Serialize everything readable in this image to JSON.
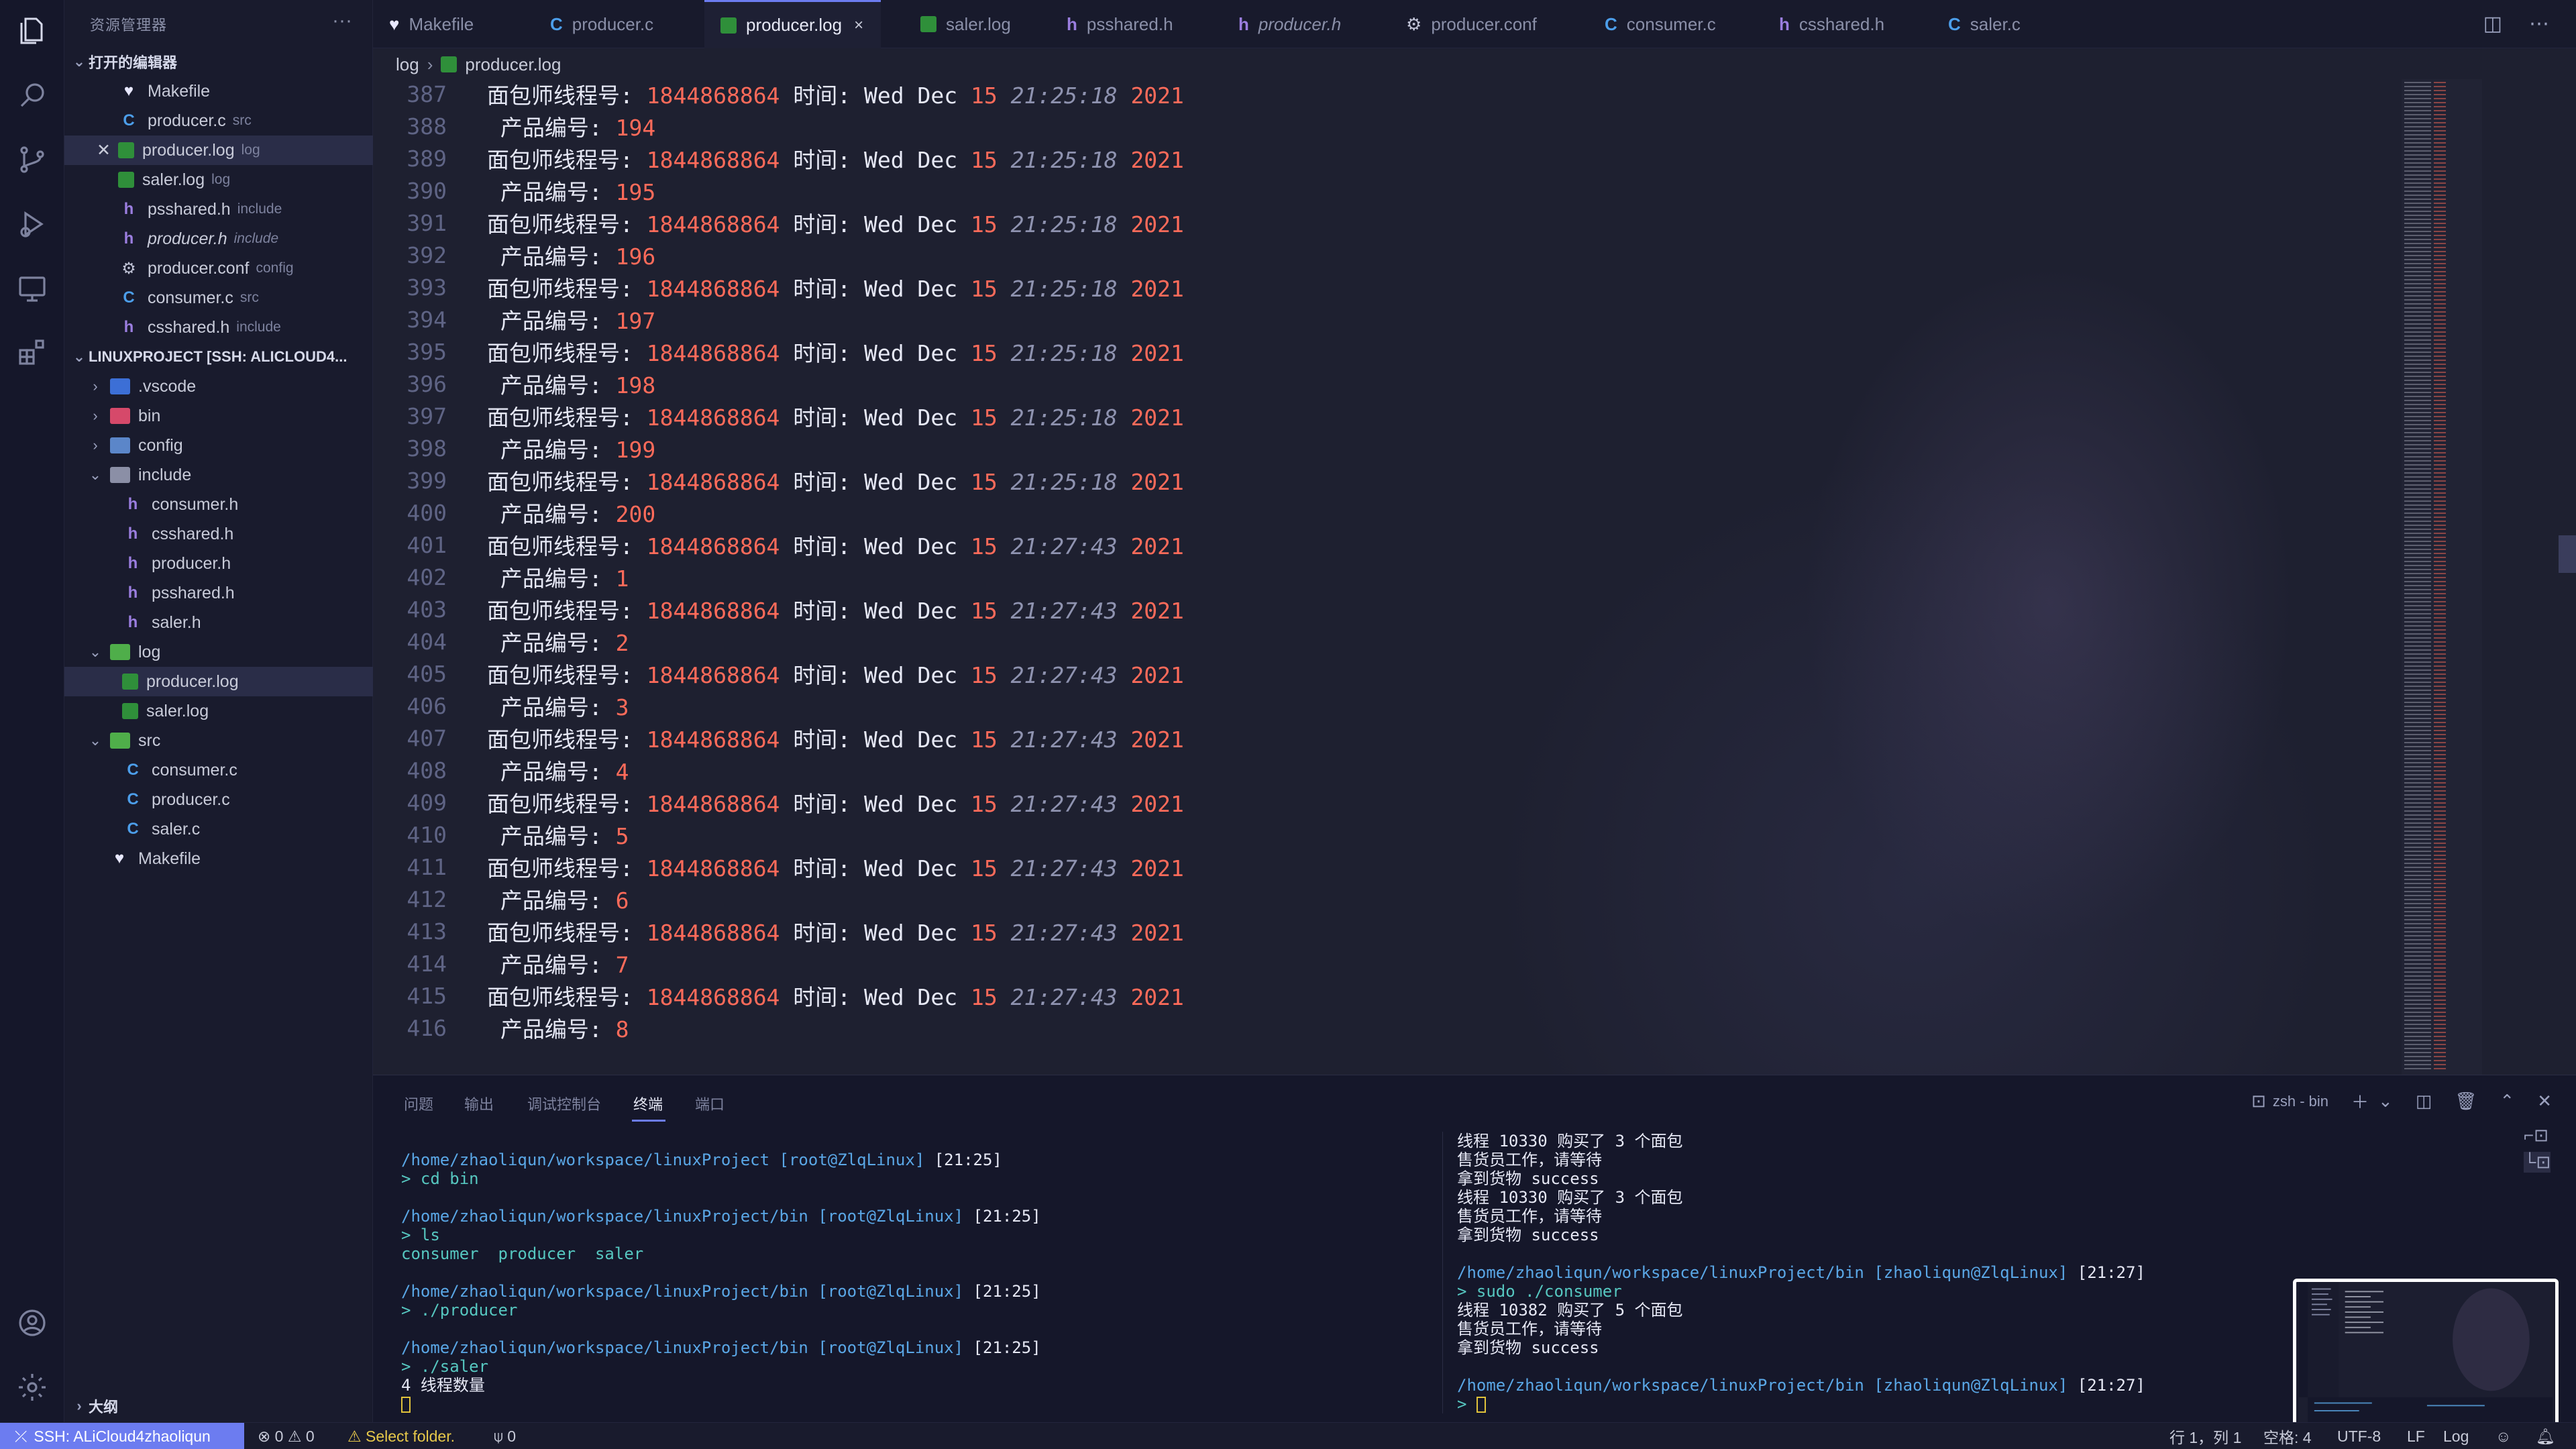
{
  "sidebar": {
    "title": "资源管理器",
    "more": "···",
    "open_editors_header": "打开的编辑器",
    "open_editors": [
      {
        "name": "Makefile",
        "hint": ""
      },
      {
        "name": "producer.c",
        "hint": "src"
      },
      {
        "name": "producer.log",
        "hint": "log"
      },
      {
        "name": "saler.log",
        "hint": "log"
      },
      {
        "name": "psshared.h",
        "hint": "include"
      },
      {
        "name": "producer.h",
        "hint": "include"
      },
      {
        "name": "producer.conf",
        "hint": "config"
      },
      {
        "name": "consumer.c",
        "hint": "src"
      },
      {
        "name": "csshared.h",
        "hint": "include"
      }
    ],
    "project_header": "LINUXPROJECT [SSH: ALICLOUD4...",
    "tree": [
      {
        "name": ".vscode"
      },
      {
        "name": "bin"
      },
      {
        "name": "config"
      },
      {
        "name": "include"
      },
      {
        "name": "consumer.h"
      },
      {
        "name": "csshared.h"
      },
      {
        "name": "producer.h"
      },
      {
        "name": "psshared.h"
      },
      {
        "name": "saler.h"
      },
      {
        "name": "log"
      },
      {
        "name": "producer.log"
      },
      {
        "name": "saler.log"
      },
      {
        "name": "src"
      },
      {
        "name": "consumer.c"
      },
      {
        "name": "producer.c"
      },
      {
        "name": "saler.c"
      },
      {
        "name": "Makefile"
      }
    ],
    "outline_header": "大纲"
  },
  "tabs": [
    {
      "label": "Makefile"
    },
    {
      "label": "producer.c"
    },
    {
      "label": "producer.log"
    },
    {
      "label": "saler.log"
    },
    {
      "label": "psshared.h"
    },
    {
      "label": "producer.h"
    },
    {
      "label": "producer.conf"
    },
    {
      "label": "consumer.c"
    },
    {
      "label": "csshared.h"
    },
    {
      "label": "saler.c"
    }
  ],
  "tab_close": "×",
  "breadcrumb": {
    "folder": "log",
    "file": "producer.log"
  },
  "editor": {
    "baker_label": "面包师线程号:",
    "product_label": "产品编号:",
    "time_label": "时间:",
    "thread_id": "1844868864",
    "weekday": "Wed Dec",
    "day": "15",
    "year": "2021",
    "lines": [
      {
        "n": "388",
        "kind": "product",
        "value": "194"
      },
      {
        "n": "389",
        "kind": "baker",
        "time": "21:25:18"
      },
      {
        "n": "390",
        "kind": "product",
        "value": "195"
      },
      {
        "n": "391",
        "kind": "baker",
        "time": "21:25:18"
      },
      {
        "n": "392",
        "kind": "product",
        "value": "196"
      },
      {
        "n": "393",
        "kind": "baker",
        "time": "21:25:18"
      },
      {
        "n": "394",
        "kind": "product",
        "value": "197"
      },
      {
        "n": "395",
        "kind": "baker",
        "time": "21:25:18"
      },
      {
        "n": "396",
        "kind": "product",
        "value": "198"
      },
      {
        "n": "397",
        "kind": "baker",
        "time": "21:25:18"
      },
      {
        "n": "398",
        "kind": "product",
        "value": "199"
      },
      {
        "n": "399",
        "kind": "baker",
        "time": "21:25:18"
      },
      {
        "n": "400",
        "kind": "product",
        "value": "200"
      },
      {
        "n": "401",
        "kind": "baker",
        "time": "21:27:43"
      },
      {
        "n": "402",
        "kind": "product",
        "value": "1"
      },
      {
        "n": "403",
        "kind": "baker",
        "time": "21:27:43"
      },
      {
        "n": "404",
        "kind": "product",
        "value": "2"
      },
      {
        "n": "405",
        "kind": "baker",
        "time": "21:27:43"
      },
      {
        "n": "406",
        "kind": "product",
        "value": "3"
      },
      {
        "n": "407",
        "kind": "baker",
        "time": "21:27:43"
      },
      {
        "n": "408",
        "kind": "product",
        "value": "4"
      },
      {
        "n": "409",
        "kind": "baker",
        "time": "21:27:43"
      },
      {
        "n": "410",
        "kind": "product",
        "value": "5"
      },
      {
        "n": "411",
        "kind": "baker",
        "time": "21:27:43"
      },
      {
        "n": "412",
        "kind": "product",
        "value": "6"
      },
      {
        "n": "413",
        "kind": "baker",
        "time": "21:27:43"
      },
      {
        "n": "414",
        "kind": "product",
        "value": "7"
      },
      {
        "n": "415",
        "kind": "baker",
        "time": "21:27:43"
      },
      {
        "n": "416",
        "kind": "product",
        "value": "8"
      }
    ],
    "first_line": {
      "n": "387",
      "time": "21:25:18"
    }
  },
  "panel": {
    "tabs": [
      "问题",
      "输出",
      "调试控制台",
      "终端",
      "端口"
    ],
    "active_tab": "终端",
    "terminal_name": "zsh - bin",
    "left_lines": [
      {
        "type": "prompt",
        "path": "/home/zhaoliqun/workspace/linuxProject",
        "user": "[root@ZlqLinux]",
        "time": "[21:25]"
      },
      {
        "type": "cmd",
        "text": "> cd bin"
      },
      {
        "type": "blank"
      },
      {
        "type": "prompt",
        "path": "/home/zhaoliqun/workspace/linuxProject/bin",
        "user": "[root@ZlqLinux]",
        "time": "[21:25]"
      },
      {
        "type": "cmd",
        "text": "> ls"
      },
      {
        "type": "green",
        "text": "consumer  producer  saler"
      },
      {
        "type": "blank"
      },
      {
        "type": "prompt",
        "path": "/home/zhaoliqun/workspace/linuxProject/bin",
        "user": "[root@ZlqLinux]",
        "time": "[21:25]"
      },
      {
        "type": "cmd",
        "text": "> ./producer"
      },
      {
        "type": "blank"
      },
      {
        "type": "prompt",
        "path": "/home/zhaoliqun/workspace/linuxProject/bin",
        "user": "[root@ZlqLinux]",
        "time": "[21:25]"
      },
      {
        "type": "cmd",
        "text": "> ./saler"
      },
      {
        "type": "out",
        "text": "4 线程数量"
      }
    ],
    "right_lines": [
      {
        "type": "out",
        "text": "线程 10330 购买了 3 个面包"
      },
      {
        "type": "out",
        "text": "售货员工作，请等待"
      },
      {
        "type": "out",
        "text": "拿到货物 success"
      },
      {
        "type": "out",
        "text": "线程 10330 购买了 3 个面包"
      },
      {
        "type": "out",
        "text": "售货员工作，请等待"
      },
      {
        "type": "out",
        "text": "拿到货物 success"
      },
      {
        "type": "blank"
      },
      {
        "type": "prompt",
        "path": "/home/zhaoliqun/workspace/linuxProject/bin",
        "user": "[zhaoliqun@ZlqLinux]",
        "time": "[21:27]"
      },
      {
        "type": "cmd",
        "text": "> sudo ./consumer"
      },
      {
        "type": "out",
        "text": "线程 10382 购买了 5 个面包"
      },
      {
        "type": "out",
        "text": "售货员工作，请等待"
      },
      {
        "type": "out",
        "text": "拿到货物 success"
      },
      {
        "type": "blank"
      },
      {
        "type": "prompt",
        "path": "/home/zhaoliqun/workspace/linuxProject/bin",
        "user": "[zhaoliqun@ZlqLinux]",
        "time": "[21:27]"
      }
    ]
  },
  "statusbar": {
    "remote": "SSH: ALiCloud4zhaoliqun",
    "errors": "0",
    "warnings": "0",
    "select_folder": "Select folder.",
    "ports": "0",
    "position": "行 1，列 1",
    "spaces": "空格: 4",
    "encoding": "UTF-8",
    "eol": "LF",
    "language": "Log"
  },
  "colors": {
    "accent": "#6c7cf0",
    "number": "#ff6b5a",
    "log_icon": "#2f8f3a"
  }
}
